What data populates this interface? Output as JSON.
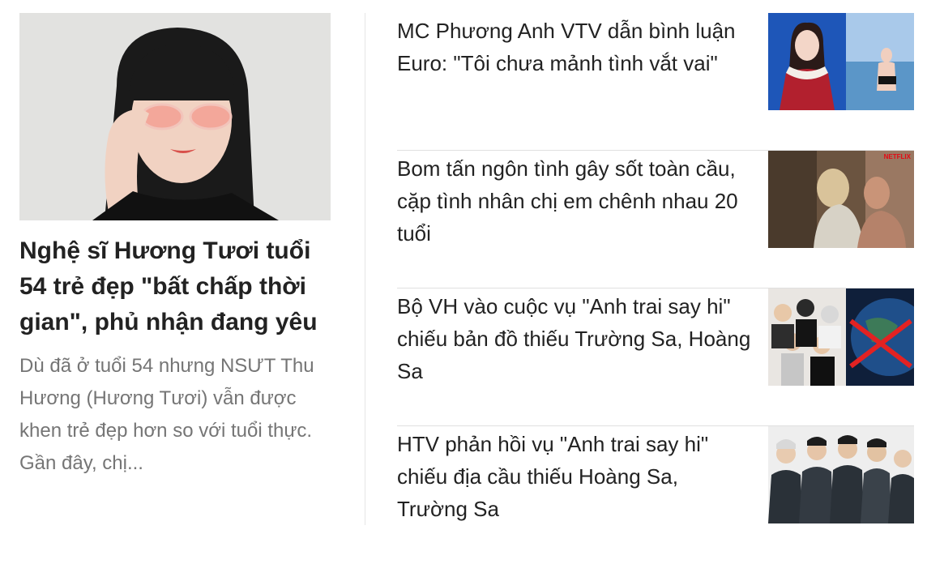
{
  "featured": {
    "title": "Nghệ sĩ Hương Tươi tuổi 54 trẻ đẹp \"bất chấp thời gian\", phủ nhận đang yêu",
    "summary": "Dù đã ở tuổi 54 nhưng NSƯT Thu Hương (Hương Tươi) vẫn được khen trẻ đẹp hơn so với tuổi thực. Gần đây, chị...",
    "thumb_icon": "portrait-photo"
  },
  "articles": [
    {
      "title": "MC Phương Anh VTV dẫn bình luận Euro: \"Tôi chưa mảnh tình vắt vai\"",
      "thumb_icon": "mc-photo"
    },
    {
      "title": "Bom tấn ngôn tình gây sốt toàn cầu, cặp tình nhân chị em chênh nhau 20 tuổi",
      "thumb_icon": "movie-still",
      "thumb_badge": "NETFLIX"
    },
    {
      "title": "Bộ VH vào cuộc vụ \"Anh trai say hi\" chiếu bản đồ thiếu Trường Sa, Hoàng Sa",
      "thumb_icon": "group-photo-map"
    },
    {
      "title": "HTV phản hồi vụ \"Anh trai say hi\" chiếu địa cầu thiếu Hoàng Sa, Trường Sa",
      "thumb_icon": "group-photo"
    }
  ]
}
